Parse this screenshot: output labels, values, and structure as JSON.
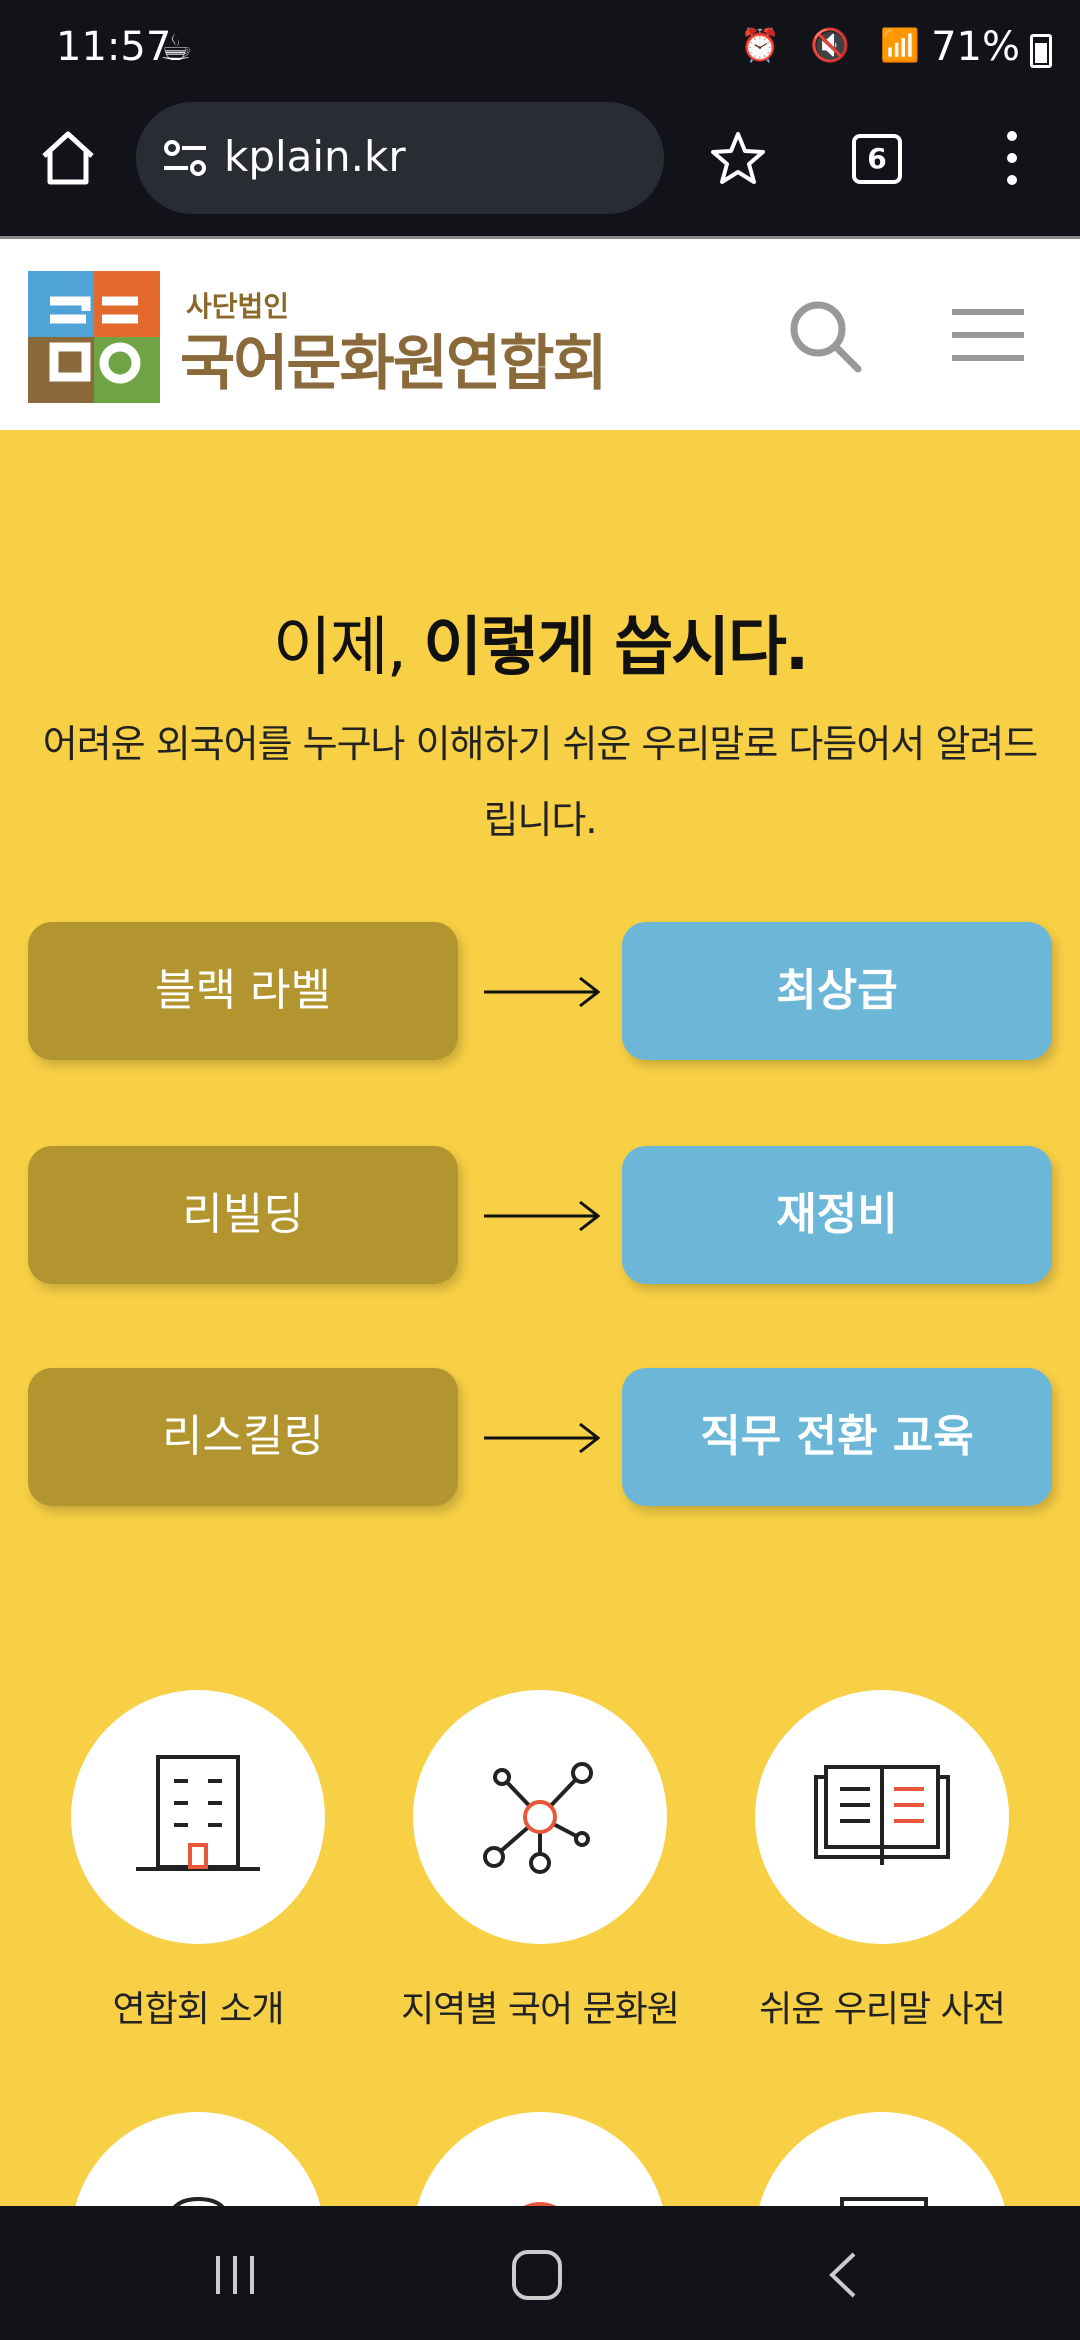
{
  "status": {
    "time": "11:57",
    "battery": "71%"
  },
  "browser": {
    "url": "kplain.kr",
    "tab_count": "6"
  },
  "header": {
    "logo_sub": "사단법인",
    "logo_main": "국어문화원연합회"
  },
  "hero": {
    "title_normal": "이제, ",
    "title_bold": "이렇게 씁시다.",
    "description": "어려운 외국어를 누구나 이해하기 쉬운 우리말로 다듬어서 알려드립니다."
  },
  "words": [
    {
      "old": "블랙 라벨",
      "new": "최상급"
    },
    {
      "old": "리빌딩",
      "new": "재정비"
    },
    {
      "old": "리스킬링",
      "new": "직무 전환 교육"
    }
  ],
  "menu": [
    {
      "label": "연합회 소개",
      "icon": "building-icon"
    },
    {
      "label": "지역별 국어 문화원",
      "icon": "network-icon"
    },
    {
      "label": "쉬운 우리말 사전",
      "icon": "book-icon"
    }
  ],
  "colors": {
    "background": "#f7d046",
    "old_word": "#b3952f",
    "new_word": "#6cb6d8",
    "accent": "#e8573a"
  }
}
